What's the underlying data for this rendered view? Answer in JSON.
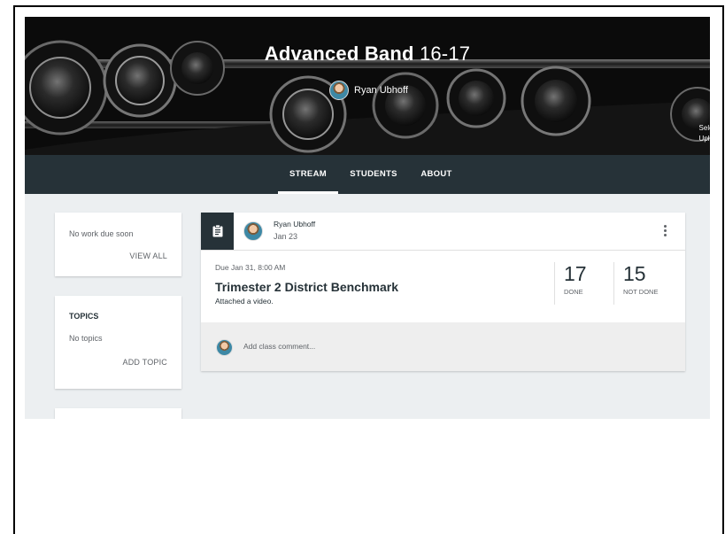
{
  "header": {
    "class_name": "Advanced Band",
    "class_section": "16-17",
    "teacher_name": "Ryan Ubhoff",
    "upload_hint_line1": "Sele",
    "upload_hint_line2": "Uplo"
  },
  "nav": {
    "tabs": [
      {
        "label": "STREAM",
        "active": true
      },
      {
        "label": "STUDENTS",
        "active": false
      },
      {
        "label": "ABOUT",
        "active": false
      }
    ]
  },
  "upcoming": {
    "message": "No work due soon",
    "view_all_label": "VIEW ALL"
  },
  "topics": {
    "heading": "TOPICS",
    "empty_message": "No topics",
    "add_topic_label": "ADD TOPIC"
  },
  "post": {
    "author": "Ryan Ubhoff",
    "date": "Jan 23",
    "due": "Due Jan 31, 8:00 AM",
    "title": "Trimester 2 District Benchmark",
    "description": "Attached a video.",
    "done_count": "17",
    "done_label": "DONE",
    "not_done_count": "15",
    "not_done_label": "NOT DONE",
    "comment_placeholder": "Add class comment..."
  },
  "colors": {
    "nav_bg": "#263238",
    "content_bg": "#eceff1",
    "banner_bg": "#0e0e0e"
  }
}
